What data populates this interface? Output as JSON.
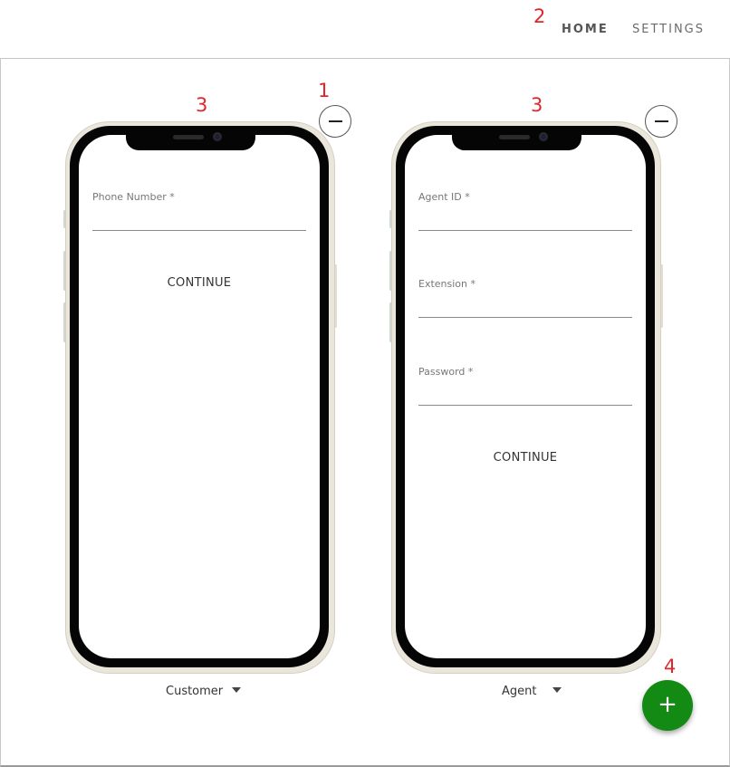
{
  "nav": {
    "home_label": "HOME",
    "settings_label": "SETTINGS"
  },
  "annotations": [
    "1",
    "2",
    "3",
    "3",
    "4"
  ],
  "phones": [
    {
      "title_annotation": "3",
      "fields": [
        {
          "label": "Phone Number *",
          "value": ""
        }
      ],
      "continue_label": "CONTINUE",
      "role": "Customer"
    },
    {
      "title_annotation": "3",
      "fields": [
        {
          "label": "Agent ID *",
          "value": ""
        },
        {
          "label": "Extension *",
          "value": ""
        },
        {
          "label": "Password *",
          "value": ""
        }
      ],
      "continue_label": "CONTINUE",
      "role": "Agent"
    }
  ],
  "fab": {
    "label": "+",
    "color": "#138a13"
  },
  "icons": {
    "remove": "minus-circle-icon",
    "dropdown": "caret-down-icon",
    "add": "plus-icon"
  }
}
